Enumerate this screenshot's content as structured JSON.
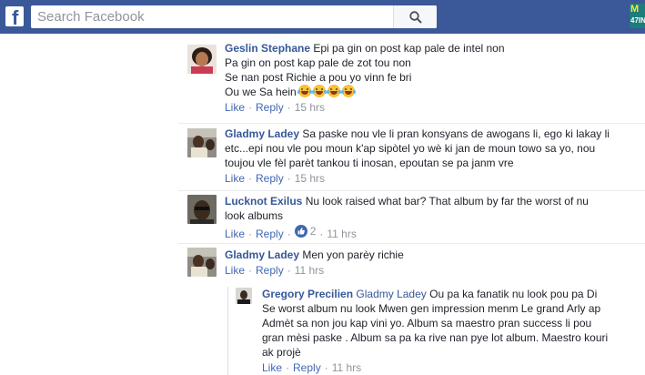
{
  "header": {
    "logo": "f",
    "search_placeholder": "Search Facebook",
    "badge_line1": "M",
    "badge_line2": "47IN"
  },
  "actions": {
    "like": "Like",
    "reply": "Reply",
    "separator": "·"
  },
  "comments": [
    {
      "author": "Geslin Stephane",
      "lines": [
        "Epi pa gin on post kap pale de intel non",
        "Pa gin on post kap pale de zot tou non",
        "Se nan post Richie a pou yo vinn fe bri",
        "Ou we Sa hein"
      ],
      "emoji_count": 4,
      "emoji_name": "laughing-with-tears-emoji",
      "time": "15 hrs"
    },
    {
      "author": "Gladmy Ladey",
      "lines": [
        "Sa paske nou vle li pran konsyans de awogans li, ego ki lakay li",
        "etc...epi nou vle pou moun k'ap sipòtel yo wè ki jan de moun towo sa yo, nou",
        "toujou vle fèl parèt tankou ti inosan, epoutan se pa janm vre"
      ],
      "time": "15 hrs"
    },
    {
      "author": "Lucknot Exilus",
      "lines": [
        "Nu look raised what bar? That album by far the worst of nu",
        "look albums"
      ],
      "reactions": "2",
      "time": "11 hrs"
    },
    {
      "author": "Gladmy Ladey",
      "lines": [
        "Men yon parèy richie"
      ],
      "time": "11 hrs"
    }
  ],
  "reply": {
    "author": "Gregory Precilien",
    "mention": "Gladmy Ladey",
    "lines": [
      "Ou pa ka fanatik nu look pou pa Di",
      "Se worst album nu look Mwen gen impression menm Le grand Arly ap",
      "Admèt sa non jou kap vini yo. Album sa maestro pran success li pou",
      "gran mèsi paske . Album sa pa ka rive nan pye lot album. Maestro kouri",
      "ak projè"
    ],
    "time": "11 hrs"
  }
}
